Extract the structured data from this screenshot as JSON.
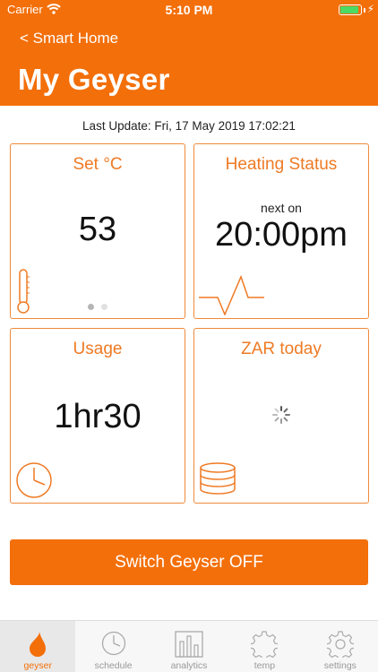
{
  "status_bar": {
    "carrier": "Carrier",
    "time": "5:10 PM",
    "battery_level": 0.95
  },
  "header": {
    "back_label": "< Smart Home",
    "title": "My Geyser",
    "color": "#f36f0a"
  },
  "last_update": "Last Update: Fri, 17 May 2019 17:02:21",
  "cards": {
    "set_temp": {
      "title": "Set °C",
      "value": "53"
    },
    "heating_status": {
      "title": "Heating Status",
      "subtitle": "next on",
      "value": "20:00pm"
    },
    "usage": {
      "title": "Usage",
      "value": "1hr30"
    },
    "zar_today": {
      "title": "ZAR today"
    }
  },
  "page_dots": {
    "count": 2,
    "active": 0
  },
  "switch_button": {
    "label": "Switch Geyser OFF"
  },
  "tabbar": {
    "items": [
      {
        "label": "geyser",
        "icon": "drop-icon",
        "active": true
      },
      {
        "label": "schedule",
        "icon": "clock-icon",
        "active": false
      },
      {
        "label": "analytics",
        "icon": "bar-chart-icon",
        "active": false
      },
      {
        "label": "temp",
        "icon": "gear-outline-icon",
        "active": false
      },
      {
        "label": "settings",
        "icon": "gear-icon",
        "active": false
      }
    ]
  },
  "colors": {
    "accent": "#f36f0a",
    "card_border": "#f08a3a",
    "card_title": "#ef7a24",
    "battery": "#4cd964"
  }
}
